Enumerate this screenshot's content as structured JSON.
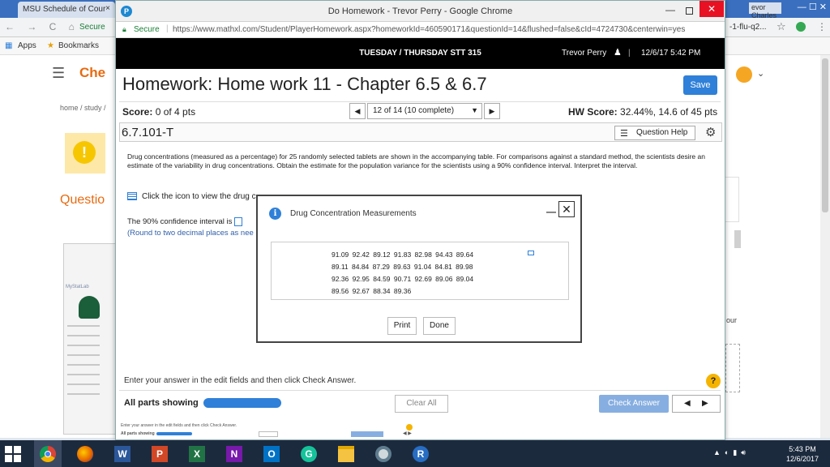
{
  "bg": {
    "tab_title": "MSU Schedule of Cour",
    "tab_close": "×",
    "right_title": "evor Charles",
    "nav_icons": "← → C ⌂",
    "secure": "Secure",
    "right_url": "-1-flu-q2...",
    "apps": "Apps",
    "bookmarks": "Bookmarks",
    "brand": "Che",
    "crumb": "home / study /",
    "questio": "Questio",
    "mystatlab": "MyStatLab",
    "right_text": "our"
  },
  "window": {
    "title": "Do Homework - Trevor Perry - Google Chrome",
    "p_icon": "P",
    "secure": "Secure",
    "url": "https://www.mathxl.com/Student/PlayerHomework.aspx?homeworkId=460590171&questionId=14&flushed=false&cId=4724730&centerwin=yes",
    "close": "✕",
    "min": "—"
  },
  "header": {
    "course": "TUESDAY / THURSDAY STT 315",
    "user": "Trevor Perry",
    "datetime": "12/6/17 5:42 PM"
  },
  "homework": {
    "title": "Homework: Home work 11 - Chapter 6.5 & 6.7",
    "save": "Save",
    "score_label": "Score:",
    "score_value": "0 of 4 pts",
    "question_nav": "12 of 14 (10 complete)",
    "hw_score_label": "HW Score:",
    "hw_score_value": "32.44%, 14.6 of 45 pts",
    "question_id": "6.7.101-T",
    "question_help": "Question Help",
    "question_text": "Drug concentrations (measured as a percentage) for 25 randomly selected tablets are shown in the accompanying table. For comparisons against a standard method, the scientists desire an estimate of the variability in drug concentrations. Obtain the estimate for the population variance for the scientists using a 90% confidence interval. Interpret the interval.",
    "table_link": "Click the icon to view the drug c",
    "ci_text": "The 90% confidence interval is",
    "ci_round": "(Round to two decimal places as nee",
    "enter_hint": "Enter your answer in the edit fields and then click Check Answer.",
    "parts_showing": "All parts showing",
    "clear_all": "Clear All",
    "check_answer": "Check Answer",
    "help_mark": "?",
    "prev": "◀",
    "next": "▶"
  },
  "dialog": {
    "title": "Drug Concentration Measurements",
    "info": "i",
    "close": "✕",
    "min": "—",
    "rows": [
      "91.09 92.42 89.12 91.83 82.98 94.43 89.64",
      "89.11 84.84 87.29 89.63 91.04 84.81 89.98",
      "92.36 92.95 84.59 90.71 92.69 89.06 89.04",
      "89.56 92.67 88.34 89.36"
    ],
    "print": "Print",
    "done": "Done"
  },
  "mini": {
    "hint": "Enter your answer in the edit fields and then click Check Answer.",
    "parts": "All parts showing",
    "clear": "Clear All",
    "check": "Check Answer"
  },
  "taskbar": {
    "time": "5:43 PM",
    "date": "12/6/2017",
    "apps": [
      "windows-start",
      "chrome",
      "firefox",
      "word",
      "powerpoint",
      "excel",
      "onenote",
      "outlook",
      "grammarly",
      "file-explorer",
      "chrome-remote",
      "r-studio"
    ]
  }
}
